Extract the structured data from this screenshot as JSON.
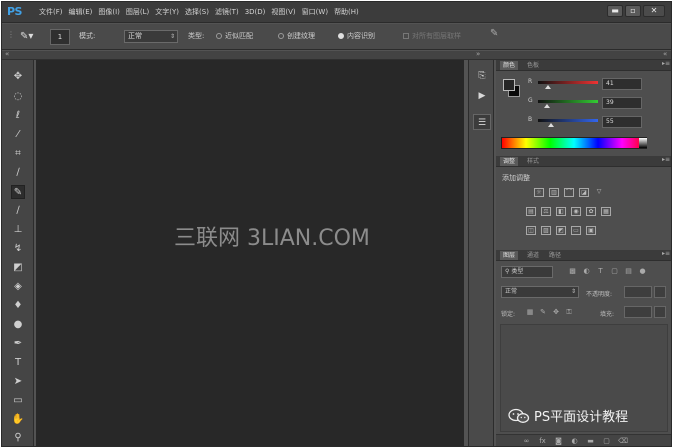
{
  "app": {
    "logo": "PS",
    "menu": [
      "文件(F)",
      "编辑(E)",
      "图像(I)",
      "图层(L)",
      "文字(Y)",
      "选择(S)",
      "滤镜(T)",
      "3D(D)",
      "视图(V)",
      "窗口(W)",
      "帮助(H)"
    ],
    "window_controls": {
      "minimize": "▬",
      "restore": "▫",
      "close": "✕"
    }
  },
  "options": {
    "brush_size": "1",
    "mode_label": "模式:",
    "mode_value": "正常",
    "type_label": "类型:",
    "type_options": [
      "近似匹配",
      "创建纹理",
      "内容识别"
    ],
    "type_selected": 2,
    "sample_all_label": "对所有图层取样"
  },
  "canvas": {
    "watermark": "三联网 3LIAN.COM"
  },
  "color_panel": {
    "tabs": [
      "颜色",
      "色板"
    ],
    "r_label": "R",
    "r_value": "41",
    "g_label": "G",
    "g_value": "39",
    "b_label": "B",
    "b_value": "55",
    "r": 41,
    "g": 39,
    "b": 55
  },
  "adjustments_panel": {
    "tabs": [
      "调整",
      "样式"
    ],
    "title": "添加调整"
  },
  "layers_panel": {
    "tabs": [
      "图层",
      "通道",
      "路径"
    ],
    "filter_label": "类型",
    "blend_mode": "正常",
    "opacity_label": "不透明度:",
    "lock_label": "锁定:",
    "fill_label": "填充:"
  },
  "badge": {
    "text": "PS平面设计教程"
  }
}
